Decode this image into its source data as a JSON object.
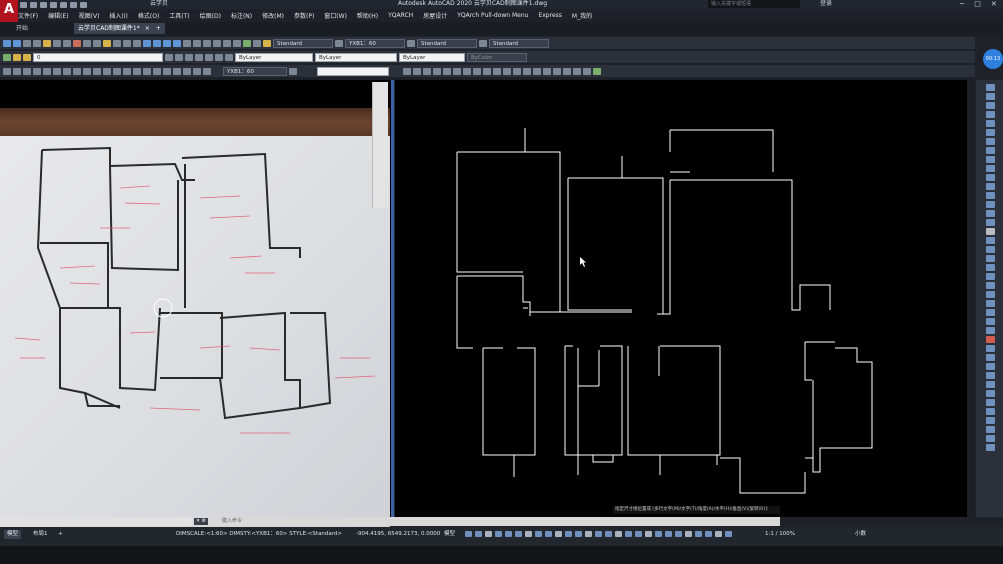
{
  "app": {
    "logo": "A",
    "workspace": "云学贝",
    "title": "Autodesk AutoCAD 2020   云学贝CAD制图课件1.dwg",
    "search_placeholder": "输入关键字或短语",
    "login": "登录",
    "window_buttons": [
      "─",
      "□",
      "✕"
    ]
  },
  "menu": [
    "文件(F)",
    "编辑(E)",
    "视图(V)",
    "插入(I)",
    "格式(O)",
    "工具(T)",
    "绘图(D)",
    "标注(N)",
    "修改(M)",
    "参数(P)",
    "窗口(W)",
    "帮助(H)",
    "YQARCH",
    "房屋设计",
    "YQArch Pull-down Menu",
    "Express",
    "M_我的"
  ],
  "tabs": {
    "start": "开始",
    "doc": "云学贝CAD制图课件1*",
    "close": "×",
    "add": "+"
  },
  "toolbar2": {
    "text_style": "Standard",
    "dim_style": "YXB1：60",
    "table_style": "Standard",
    "multileader_style": "Standard"
  },
  "toolbar3": {
    "layer": "0",
    "color": "ByLayer",
    "linetype": "ByLayer",
    "lineweight": "ByLayer",
    "plotstyle": "ByColor"
  },
  "toolbar4": {
    "dim_style": "YXB1：60"
  },
  "navcube": {
    "label": "00:13"
  },
  "command": {
    "close": "✕ ⚙",
    "placeholder": "键入命令"
  },
  "dim_tooltip": "指定尺寸线位置或 [多行文字(M)/文字(T)/角度(A)/水平(H)/垂直(V)/旋转(R)]:",
  "status": {
    "model_tab": "模型",
    "layout_tab": "布局1",
    "add": "+",
    "dim_vars": "DIMSCALE:<1:60> DIMSTY:<YXB1：60> STYLE:<Standard>",
    "coords": "-904.4195, 6549.2173, 0.0000",
    "mode": "模型",
    "scale": "1:1 / 100%",
    "decimal": "小数"
  },
  "colors": {
    "accent": "#2d7fe0",
    "logo": "#b0131c",
    "cad_bg": "#000000",
    "line": "#ffffff"
  }
}
